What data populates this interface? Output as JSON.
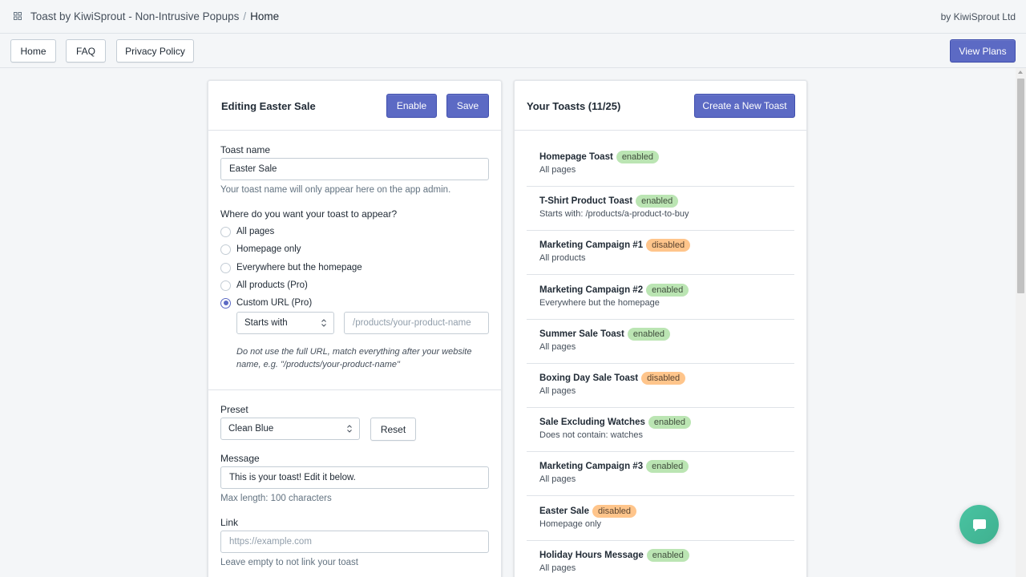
{
  "header": {
    "app_name": "Toast by KiwiSprout - Non-Intrusive Popups",
    "separator": "/",
    "current_page": "Home",
    "byline": "by KiwiSprout Ltd"
  },
  "nav": {
    "home_label": "Home",
    "faq_label": "FAQ",
    "privacy_label": "Privacy Policy",
    "view_plans_label": "View Plans"
  },
  "editor": {
    "title": "Editing Easter Sale",
    "enable_label": "Enable",
    "save_label": "Save",
    "toast_name_label": "Toast name",
    "toast_name_value": "Easter Sale",
    "toast_name_help": "Your toast name will only appear here on the app admin.",
    "location_label": "Where do you want your toast to appear?",
    "location_options": [
      {
        "label": "All pages",
        "checked": false
      },
      {
        "label": "Homepage only",
        "checked": false
      },
      {
        "label": "Everywhere but the homepage",
        "checked": false
      },
      {
        "label": "All products (Pro)",
        "checked": false
      },
      {
        "label": "Custom URL (Pro)",
        "checked": true
      }
    ],
    "match_type": "Starts with",
    "url_placeholder": "/products/your-product-name",
    "url_note": "Do not use the full URL, match everything after your website name, e.g. \"/products/your-product-name\"",
    "preset_label": "Preset",
    "preset_value": "Clean Blue",
    "reset_label": "Reset",
    "message_label": "Message",
    "message_value": "This is your toast! Edit it below.",
    "message_help": "Max length: 100 characters",
    "link_label": "Link",
    "link_placeholder": "https://example.com",
    "link_help": "Leave empty to not link your toast"
  },
  "toasts": {
    "title": "Your Toasts (11/25)",
    "create_label": "Create a New Toast",
    "items": [
      {
        "name": "Homepage Toast",
        "status": "enabled",
        "target": "All pages"
      },
      {
        "name": "T-Shirt Product Toast",
        "status": "enabled",
        "target": "Starts with: /products/a-product-to-buy"
      },
      {
        "name": "Marketing Campaign #1",
        "status": "disabled",
        "target": "All products"
      },
      {
        "name": "Marketing Campaign #2",
        "status": "enabled",
        "target": "Everywhere but the homepage"
      },
      {
        "name": "Summer Sale Toast",
        "status": "enabled",
        "target": "All pages"
      },
      {
        "name": "Boxing Day Sale Toast",
        "status": "disabled",
        "target": "All pages"
      },
      {
        "name": "Sale Excluding Watches",
        "status": "enabled",
        "target": "Does not contain: watches"
      },
      {
        "name": "Marketing Campaign #3",
        "status": "enabled",
        "target": "All pages"
      },
      {
        "name": "Easter Sale",
        "status": "disabled",
        "target": "Homepage only"
      },
      {
        "name": "Holiday Hours Message",
        "status": "enabled",
        "target": "All pages"
      }
    ]
  },
  "colors": {
    "primary": "#5c6ac4",
    "enabled_badge": "#bbe5b3",
    "disabled_badge": "#ffc58b",
    "chat_button": "#47bf9c"
  },
  "icons": {
    "app": "grid-icon",
    "chat": "chat-bubble-icon",
    "select": "select-arrows-icon"
  }
}
